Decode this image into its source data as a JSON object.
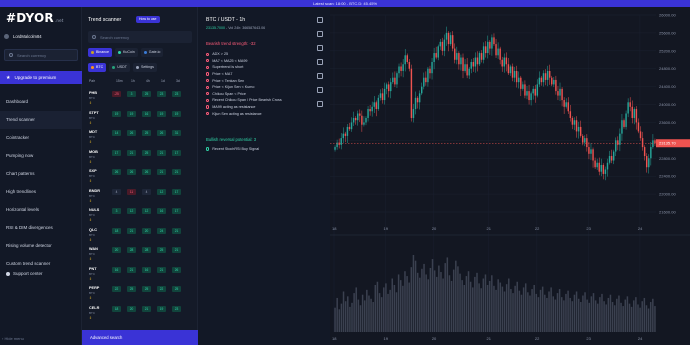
{
  "topbar": {
    "text": "Latest scan: 18:00 - BTC.D: 45.45%"
  },
  "sidebar": {
    "logo": "#DYOR",
    "logo_suffix": ".net",
    "user": "LordMalcolm84",
    "search_placeholder": "Search currency",
    "upgrade": "Upgrade to premium",
    "items": [
      {
        "label": "Dashboard"
      },
      {
        "label": "Trend scanner"
      },
      {
        "label": "Cointracker"
      },
      {
        "label": "Pumping now"
      },
      {
        "label": "Chart patterns"
      },
      {
        "label": "High trendlines"
      },
      {
        "label": "Horizontal levels"
      },
      {
        "label": "RSI & DIM divergences"
      },
      {
        "label": "Rising volume detector"
      },
      {
        "label": "Custom trend scanner"
      }
    ],
    "support": "Support center",
    "collapse": "Hide menu"
  },
  "scanner": {
    "title": "Trend scanner",
    "howto": "How to use",
    "search_placeholder": "Search currency",
    "exchanges": [
      "Binance",
      "KuCoin",
      "Gate.io"
    ],
    "filters": [
      "BTC",
      "USDT",
      "Settings"
    ],
    "columns": [
      "Pair",
      "15m",
      "1h",
      "4h",
      "1d",
      "3d"
    ],
    "rows": [
      {
        "pair": "PHB",
        "quote": "BTC",
        "cells": [
          [
            "-25",
            "dn"
          ],
          [
            "3",
            "up"
          ],
          [
            "25",
            "up"
          ],
          [
            "23",
            "up"
          ],
          [
            "23",
            "up"
          ]
        ]
      },
      {
        "pair": "STPT",
        "quote": "BTC",
        "cells": [
          [
            "19",
            "up"
          ],
          [
            "19",
            "up"
          ],
          [
            "16",
            "up"
          ],
          [
            "19",
            "up"
          ],
          [
            "19",
            "up"
          ]
        ]
      },
      {
        "pair": "MDT",
        "quote": "BTC",
        "cells": [
          [
            "14",
            "up"
          ],
          [
            "26",
            "up"
          ],
          [
            "25",
            "up"
          ],
          [
            "26",
            "up"
          ],
          [
            "31",
            "up"
          ]
        ]
      },
      {
        "pair": "MOB",
        "quote": "BTC",
        "cells": [
          [
            "17",
            "up"
          ],
          [
            "21",
            "up"
          ],
          [
            "25",
            "up"
          ],
          [
            "21",
            "up"
          ],
          [
            "17",
            "up"
          ]
        ]
      },
      {
        "pair": "SXP",
        "quote": "BTC",
        "cells": [
          [
            "26",
            "up"
          ],
          [
            "26",
            "up"
          ],
          [
            "26",
            "up"
          ],
          [
            "21",
            "up"
          ],
          [
            "21",
            "up"
          ]
        ]
      },
      {
        "pair": "BNDR",
        "quote": "BTC",
        "cells": [
          [
            "4",
            "nt"
          ],
          [
            "11",
            "dn"
          ],
          [
            "4",
            "nt"
          ],
          [
            "12",
            "up"
          ],
          [
            "17",
            "up"
          ]
        ]
      },
      {
        "pair": "NULS",
        "quote": "BTC",
        "cells": [
          [
            "3",
            "up"
          ],
          [
            "12",
            "up"
          ],
          [
            "12",
            "up"
          ],
          [
            "16",
            "up"
          ],
          [
            "17",
            "up"
          ]
        ]
      },
      {
        "pair": "QLC",
        "quote": "BTC",
        "cells": [
          [
            "18",
            "up"
          ],
          [
            "21",
            "up"
          ],
          [
            "20",
            "up"
          ],
          [
            "24",
            "up"
          ],
          [
            "21",
            "up"
          ]
        ]
      },
      {
        "pair": "WAN",
        "quote": "BTC",
        "cells": [
          [
            "20",
            "up"
          ],
          [
            "28",
            "up"
          ],
          [
            "28",
            "up"
          ],
          [
            "25",
            "up"
          ],
          [
            "21",
            "up"
          ]
        ]
      },
      {
        "pair": "PNT",
        "quote": "BTC",
        "cells": [
          [
            "16",
            "up"
          ],
          [
            "21",
            "up"
          ],
          [
            "16",
            "up"
          ],
          [
            "21",
            "up"
          ],
          [
            "26",
            "up"
          ]
        ]
      },
      {
        "pair": "PERP",
        "quote": "BTC",
        "cells": [
          [
            "22",
            "up"
          ],
          [
            "25",
            "up"
          ],
          [
            "25",
            "up"
          ],
          [
            "22",
            "up"
          ],
          [
            "25",
            "up"
          ]
        ]
      },
      {
        "pair": "CELR",
        "quote": "BTC",
        "cells": [
          [
            "18",
            "up"
          ],
          [
            "20",
            "up"
          ],
          [
            "21",
            "up"
          ],
          [
            "19",
            "up"
          ],
          [
            "23",
            "up"
          ]
        ]
      }
    ],
    "advanced": "Advanced search"
  },
  "details": {
    "title": "BTC / USDT - 1h",
    "price": "23135.7000",
    "volume": "Vol 24h: 366587643.06",
    "bear_title": "Bearish trend strength: -32",
    "bear_signals": [
      "ADX > 25",
      "MA7 < MA25 < MA99",
      "Supertrend is short",
      "Price < MA7",
      "Price < Tenkan Sen",
      "Price < Kijun Sen < Kumo",
      "Chikou Span < Price",
      "Recent Chikou Span / Price Bearish Cross",
      "MA99 acting as resistance",
      "Kijun Sen acting as resistance"
    ],
    "bull_title": "Bullish reversal potential: 3",
    "bull_signals": [
      "Recent StochRSI Buy Signal"
    ]
  },
  "chart_data": {
    "type": "candlestick",
    "symbol": "BTC / USDT",
    "price_axis": [
      "26000.00",
      "25600.00",
      "25200.00",
      "24800.00",
      "24400.00",
      "24000.00",
      "23600.00",
      "23200.00",
      "22800.00",
      "22400.00",
      "22000.00",
      "21600.00"
    ],
    "ylim": [
      21600,
      26000
    ],
    "x_ticks": [
      "18",
      "19",
      "20",
      "21",
      "22",
      "23",
      "24"
    ],
    "current_price_label": "23135.70",
    "current_price": 23135.7,
    "colors": {
      "up": "#26a69a",
      "down": "#ef5350",
      "price_line": "#ef5350"
    },
    "closes": [
      23050,
      23150,
      23100,
      23250,
      23350,
      23300,
      23500,
      23450,
      23600,
      23700,
      23650,
      23800,
      23750,
      23550,
      23600,
      23700,
      23900,
      23850,
      23950,
      24050,
      23900,
      24150,
      24250,
      24100,
      24350,
      24450,
      24300,
      24500,
      24600,
      24450,
      24700,
      24850,
      24750,
      24900,
      25100,
      24950,
      24800,
      23700,
      23900,
      24150,
      24050,
      24250,
      24400,
      24600,
      24500,
      24800,
      24700,
      24950,
      25150,
      25050,
      25300,
      25400,
      25200,
      25450,
      25600,
      25350,
      25550,
      25250,
      25000,
      25150,
      24900,
      25050,
      24750,
      24900,
      24650,
      24800,
      24950,
      24850,
      25050,
      24900,
      25150,
      25000,
      25300,
      25150,
      25400,
      25250,
      25500,
      25350,
      25100,
      25250,
      25000,
      24850,
      25050,
      24900,
      24700,
      24850,
      24600,
      24750,
      24500,
      24600,
      24350,
      24450,
      24200,
      24300,
      24100,
      24250,
      24350,
      24200,
      24450,
      24600,
      24500,
      24700,
      24550,
      24750,
      24600,
      24450,
      24550,
      24300,
      24200,
      24350,
      24100,
      23950,
      24050,
      23850,
      23700,
      23550,
      23650,
      23400,
      23500,
      23300,
      23150,
      23250,
      23050,
      22900,
      23000,
      22750,
      22600,
      22700,
      22500,
      22650,
      22450,
      22550,
      22700,
      22850,
      22750,
      22950,
      23200,
      23100,
      23350,
      23650,
      23500,
      23800,
      24050,
      23950,
      23700,
      23900,
      23600,
      23400,
      23250,
      23050,
      22850,
      22600,
      22800,
      23050,
      23200,
      23135.7
    ],
    "volumes": [
      30,
      42,
      28,
      35,
      50,
      38,
      44,
      31,
      36,
      48,
      55,
      40,
      33,
      46,
      39,
      52,
      45,
      41,
      37,
      58,
      62,
      48,
      43,
      55,
      60,
      47,
      52,
      66,
      58,
      49,
      71,
      64,
      57,
      75,
      69,
      61,
      80,
      95,
      88,
      73,
      67,
      78,
      84,
      71,
      65,
      79,
      90,
      76,
      68,
      82,
      74,
      66,
      85,
      92,
      70,
      63,
      77,
      88,
      81,
      72,
      64,
      58,
      69,
      75,
      62,
      55,
      68,
      73,
      60,
      54,
      66,
      71,
      58,
      63,
      70,
      57,
      52,
      65,
      61,
      56,
      50,
      59,
      66,
      53,
      48,
      57,
      62,
      51,
      46,
      55,
      60,
      49,
      45,
      53,
      58,
      47,
      43,
      52,
      56,
      46,
      42,
      50,
      55,
      44,
      40,
      48,
      53,
      43,
      39,
      47,
      51,
      42,
      38,
      46,
      50,
      41,
      37,
      45,
      49,
      40,
      36,
      44,
      48,
      39,
      35,
      43,
      47,
      38,
      34,
      42,
      46,
      37,
      33,
      41,
      45,
      36,
      32,
      40,
      44,
      35,
      31,
      39,
      43,
      34,
      30,
      38,
      42,
      33,
      29,
      37,
      41,
      32
    ]
  }
}
